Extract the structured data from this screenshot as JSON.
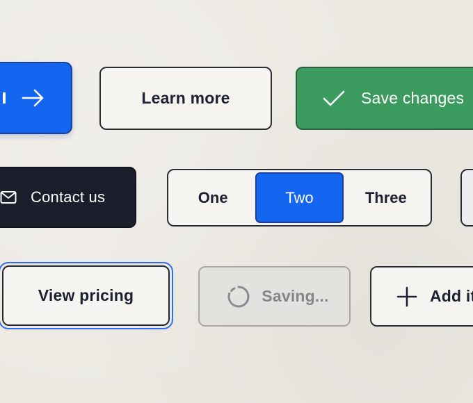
{
  "row1": {
    "primary_button": {
      "icon": "arrow-right-icon"
    },
    "learn_more_button": {
      "label": "Learn more"
    },
    "save_changes_button": {
      "label": "Save changes",
      "icon": "check-icon"
    }
  },
  "row2": {
    "contact_button": {
      "label": "Contact us",
      "icon": "mail-icon"
    },
    "segmented_control": {
      "options": [
        "One",
        "Two",
        "Three"
      ],
      "selected": "Two"
    }
  },
  "row3": {
    "view_pricing_button": {
      "label": "View pricing",
      "state": "focused"
    },
    "saving_button": {
      "label": "Saving...",
      "icon": "spinner-icon",
      "state": "disabled"
    },
    "add_item_button": {
      "label": "Add it",
      "icon": "plus-icon"
    }
  },
  "colors": {
    "background": "#ece9e3",
    "primary": "#1466f0",
    "success": "#3b9b5f",
    "dark": "#1b1f2c",
    "focus_ring": "#2f6cf0",
    "disabled_text": "#85868c"
  }
}
